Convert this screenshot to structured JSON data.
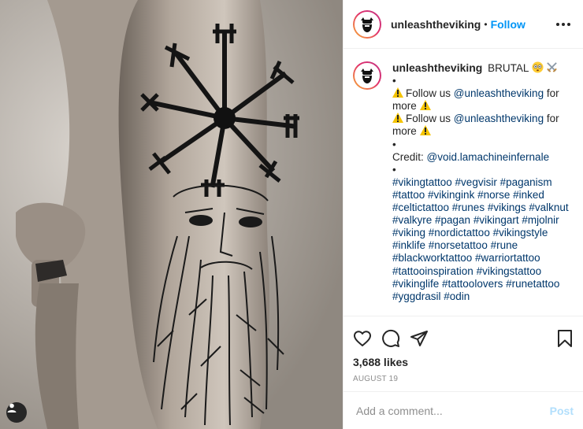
{
  "post": {
    "author": {
      "username": "unleashtheviking",
      "avatar_icon": "viking-logo-icon"
    },
    "header": {
      "separator": "•",
      "follow_label": "Follow",
      "more_icon": "more-options-icon"
    },
    "caption": {
      "text": "BRUTAL",
      "lines": [
        "•",
        "Follow us @unleashtheviking for more",
        "Follow us @unleashtheviking for more",
        "•",
        "Credit: @void.lamachineinfernale",
        "•",
        "#vikingtattoo #vegvisir #paganism #tattoo #vikingink #norse #inked #celtictattoo #runes #vikings #valknut #valkyre #pagan #vikingart #mjolnir #viking #nordictattoo #vikingstyle #inklife #norsetattoo #rune #blackworktattoo #warriortattoo #tattooinspiration #vikingstattoo #vikinglife #tattoolovers #runetattoo #yggdrasil #odin"
      ],
      "follow_text": "Follow us",
      "follow_handle": "@unleashtheviking",
      "follow_suffix": "for more",
      "credit_label": "Credit:",
      "credit_handle": "@void.lamachineinfernale",
      "hashtags": "#vikingtattoo #vegvisir #paganism #tattoo #vikingink #norse #inked #celtictattoo #runes #vikings #valknut #valkyre #pagan #vikingart #mjolnir #viking #nordictattoo #vikingstyle #inklife #norsetattoo #rune #blackworktattoo #warriortattoo #tattooinspiration #vikingstattoo #vikinglife #tattoolovers #runetattoo #yggdrasil #odin"
    },
    "stats": {
      "likes": "3,688 likes",
      "date": "AUGUST 19"
    },
    "comment_box": {
      "placeholder": "Add a comment...",
      "post_label": "Post"
    },
    "icons": [
      "heart-icon",
      "comment-icon",
      "share-icon",
      "bookmark-icon",
      "user-tag-icon",
      "warning-icon",
      "flushed-face-icon",
      "crossed-swords-icon"
    ],
    "colors": {
      "link": "#00376b",
      "follow": "#0095f6",
      "post_disabled": "#b2dffc",
      "muted": "#8e8e8e"
    }
  }
}
